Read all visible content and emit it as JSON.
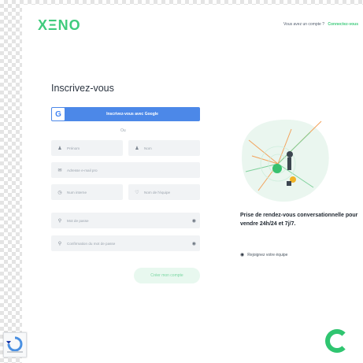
{
  "brand": {
    "logo": "XΞNO",
    "accent": "#3fcb7c"
  },
  "header": {
    "question": "Vous avez un compte ?",
    "login_link": "Connectez-vous"
  },
  "form": {
    "title": "Inscrivez-vous",
    "google_label": "Inscrivez-vous avec Google",
    "divider": "Ou",
    "firstname_placeholder": "Prénom",
    "lastname_placeholder": "Nom",
    "email_placeholder": "Adresse e-mail pro",
    "phone_placeholder": "Num interne",
    "team_placeholder": "Nom de l'équipe",
    "password_placeholder": "Mot de passe",
    "confirm_placeholder": "Confirmation du mot de passe",
    "submit_label": "Créer mon compte"
  },
  "promo": {
    "text": "Prise de rendez-vous conversationnelle pour vendre 24h/24 et 7j/7.",
    "join_label": "Rejoignez votre équipe"
  }
}
